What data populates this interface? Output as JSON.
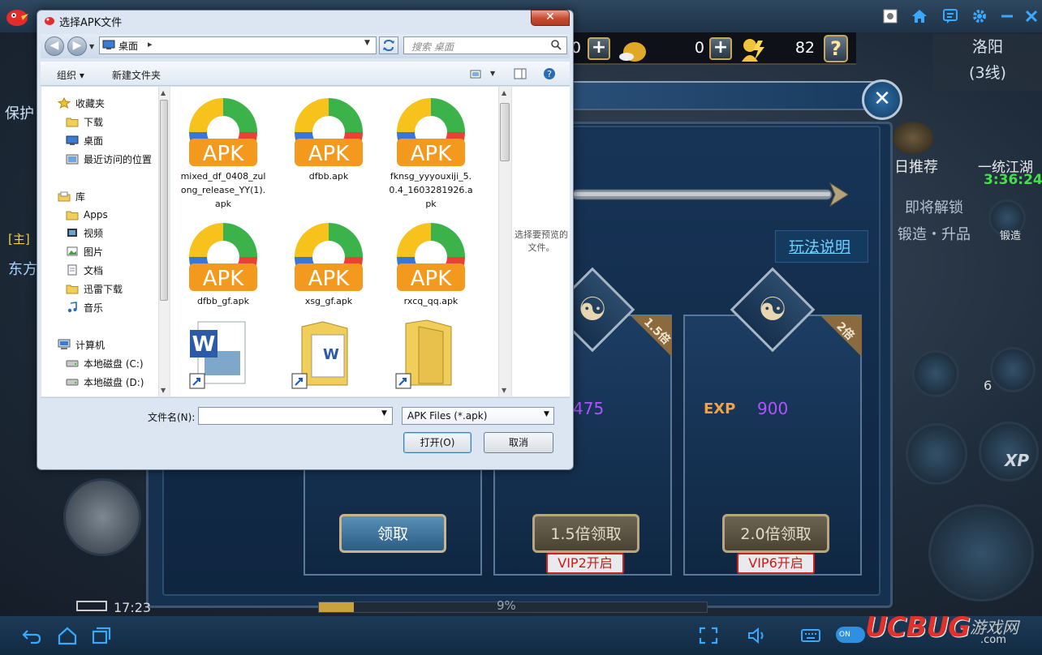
{
  "emulator": {
    "toolbar_icons": [
      "screenshot-icon",
      "home-icon",
      "feedback-icon",
      "settings-icon",
      "minimize-icon"
    ],
    "nav_icons": [
      "back-icon",
      "home-icon",
      "recent-apps-icon"
    ],
    "bottom_right_icons": [
      "fullscreen-icon",
      "volume-icon",
      "keyboard-icon",
      "toggle-switch"
    ],
    "toggle_label": "ON"
  },
  "game": {
    "hud_value_1": "0",
    "hud_value_2": "82",
    "hud_partial": "0",
    "city_name": "洛阳",
    "city_line": "(3线)",
    "side_text_1": "日推荐",
    "side_text_2": "一统江湖",
    "side_timer": "3:36:24",
    "side_text_3": "即将解锁",
    "side_text_4": "锻造・升品",
    "side_text_5": "锻造",
    "left_text_1": "保护",
    "left_text_2": "[主]",
    "left_text_3": "东方",
    "rules_link": "玩法说明",
    "ribbon_1": "1.5倍",
    "ribbon_2": "2倍",
    "exp_label": "EXP",
    "exp_value": "900",
    "exp_value_partial": "475",
    "claim_btn": "领取",
    "claim_15_btn": "1.5倍领取",
    "claim_20_btn": "2.0倍领取",
    "vip2": "VIP2开启",
    "vip6": "VIP6开启",
    "time": "17:23",
    "xp_percent": "9%",
    "skill_count": "6",
    "xp_button": "XP"
  },
  "dialog": {
    "title": "选择APK文件",
    "close_label": "✕",
    "address": "桌面",
    "address_sep": "▸",
    "search_placeholder": "搜索 桌面",
    "cmd_organize": "组织 ▾",
    "cmd_new_folder": "新建文件夹",
    "nav_tree": [
      {
        "label": "收藏夹",
        "icon": "star-icon",
        "indent": 0
      },
      {
        "label": "下载",
        "icon": "folder-icon",
        "indent": 1
      },
      {
        "label": "桌面",
        "icon": "desktop-icon",
        "indent": 1
      },
      {
        "label": "最近访问的位置",
        "icon": "recent-icon",
        "indent": 1
      },
      {
        "label": "库",
        "icon": "library-icon",
        "indent": 0
      },
      {
        "label": "Apps",
        "icon": "folder-icon",
        "indent": 1
      },
      {
        "label": "视频",
        "icon": "video-icon",
        "indent": 1
      },
      {
        "label": "图片",
        "icon": "picture-icon",
        "indent": 1
      },
      {
        "label": "文档",
        "icon": "document-icon",
        "indent": 1
      },
      {
        "label": "迅雷下载",
        "icon": "folder-icon",
        "indent": 1
      },
      {
        "label": "音乐",
        "icon": "music-icon",
        "indent": 1
      },
      {
        "label": "计算机",
        "icon": "computer-icon",
        "indent": 0
      },
      {
        "label": "本地磁盘 (C:)",
        "icon": "disk-icon",
        "indent": 1
      },
      {
        "label": "本地磁盘 (D:)",
        "icon": "disk-icon",
        "indent": 1
      }
    ],
    "files": [
      {
        "name": "mixed_df_0408_zulong_release_YY(1).apk",
        "badge": "APK"
      },
      {
        "name": "dfbb.apk",
        "badge": "APK"
      },
      {
        "name": "fknsg_yyyouxiji_5.0.4_1603281926.apk",
        "badge": "APK"
      },
      {
        "name": "dfbb_gf.apk",
        "badge": "APK"
      },
      {
        "name": "xsg_gf.apk",
        "badge": "APK"
      },
      {
        "name": "rxcq_qq.apk",
        "badge": "APK"
      }
    ],
    "preview_text": "选择要预览的文件。",
    "filename_label": "文件名(N):",
    "filename_value": "",
    "filetype_value": "APK Files  (*.apk)",
    "open_btn": "打开(O)",
    "cancel_btn": "取消"
  },
  "watermark": {
    "brand": "UCBUG",
    "suffix": "游戏网",
    "domain": ".com"
  },
  "colors": {
    "apk_badge": "#f39a1e",
    "link": "#6fd0ff",
    "vip_red": "#d01818",
    "exp_purple": "#b053ff"
  }
}
